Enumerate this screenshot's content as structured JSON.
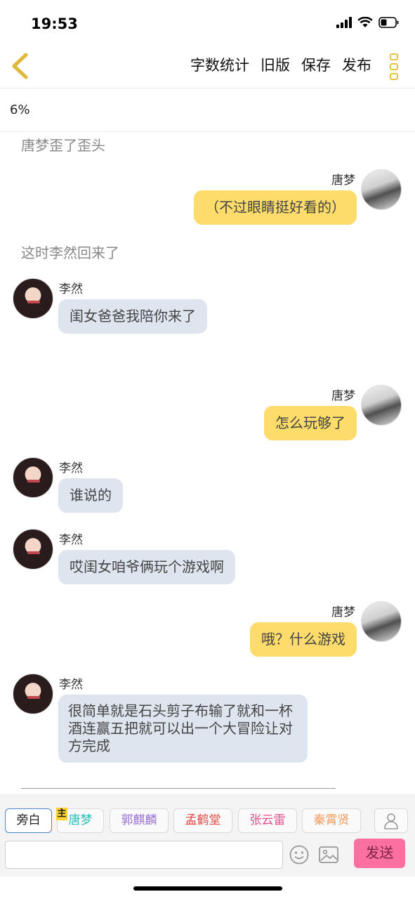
{
  "status_bar": {
    "time": "19:53"
  },
  "nav": {
    "actions": [
      "字数统计",
      "旧版",
      "保存",
      "发布"
    ]
  },
  "progress": "6%",
  "chat": {
    "narration_1": "唐梦歪了歪头",
    "narration_2": "这时李然回来了",
    "messages": [
      {
        "sender": "唐梦",
        "side": "right",
        "text": "（不过眼睛挺好看的）"
      },
      {
        "sender": "李然",
        "side": "left",
        "text": "闺女爸爸我陪你来了"
      },
      {
        "sender": "唐梦",
        "side": "right",
        "text": "怎么玩够了"
      },
      {
        "sender": "李然",
        "side": "left",
        "text": "谁说的"
      },
      {
        "sender": "李然",
        "side": "left",
        "text": "哎闺女咱爷俩玩个游戏啊"
      },
      {
        "sender": "唐梦",
        "side": "right",
        "text": "哦？什么游戏"
      },
      {
        "sender": "李然",
        "side": "left",
        "text": "很简单就是石头剪子布输了就和一杯酒连赢五把就可以出一个大冒险让对方完成"
      }
    ]
  },
  "characters": {
    "host_badge": "主",
    "tabs": [
      {
        "label": "旁白",
        "color": "#222222"
      },
      {
        "label": "唐梦",
        "color": "#2bbfb8"
      },
      {
        "label": "郭麒麟",
        "color": "#9b6fd6"
      },
      {
        "label": "孟鹤堂",
        "color": "#e0463f"
      },
      {
        "label": "张云雷",
        "color": "#e64c8c"
      },
      {
        "label": "秦霄贤",
        "color": "#f39a5c"
      }
    ]
  },
  "input": {
    "value": "",
    "placeholder": "",
    "send_label": "发送"
  },
  "colors": {
    "accent": "#fddc6c",
    "left_bubble": "#dee5ef",
    "send": "#fb6fa1"
  }
}
